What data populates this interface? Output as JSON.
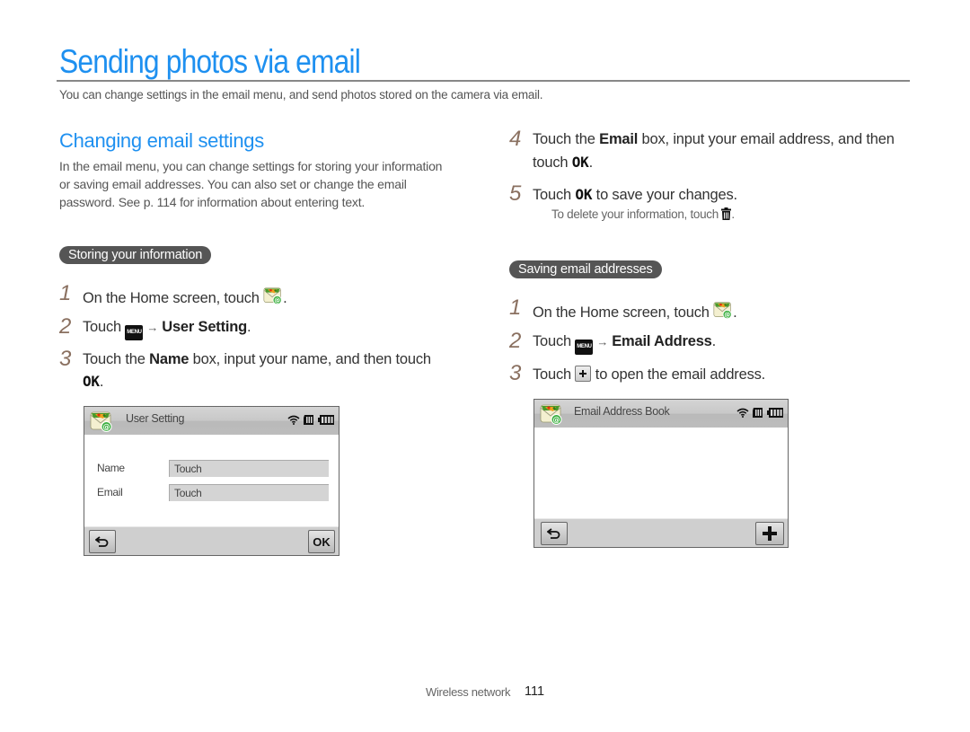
{
  "header": {
    "title": "Sending photos via email",
    "intro": "You can change settings in the email menu, and send photos stored on the camera via email."
  },
  "section": {
    "title": "Changing email settings",
    "description": "In the email menu, you can change settings for storing your information or saving email addresses. You can also set or change the email password. See p. 114 for information about entering text."
  },
  "storing": {
    "label": "Storing your information",
    "steps": [
      {
        "num": "1",
        "pre": "On the Home screen, touch ",
        "post": "."
      },
      {
        "num": "2",
        "pre": "Touch ",
        "menu": "MENU",
        "arrow": "→",
        "bold": "User Setting",
        "post": "."
      },
      {
        "num": "3",
        "pre": "Touch the ",
        "bold": "Name",
        "mid": " box, input your name, and then touch",
        "ok": "OK",
        "post": "."
      },
      {
        "num": "4",
        "pre": "Touch the ",
        "bold": "Email",
        "mid": " box, input your email address, and then",
        "line2": "touch ",
        "ok": "OK",
        "post": "."
      },
      {
        "num": "5",
        "pre": "Touch ",
        "ok": "OK",
        "post": " to save your changes."
      }
    ],
    "note_pre": "To delete your information, touch ",
    "note_post": ".",
    "screen": {
      "title": "User Setting",
      "fields": [
        {
          "label": "Name",
          "value": "Touch"
        },
        {
          "label": "Email",
          "value": "Touch"
        }
      ],
      "ok_label": "OK"
    }
  },
  "saving": {
    "label": "Saving email addresses",
    "steps": [
      {
        "num": "1",
        "pre": "On the Home screen, touch ",
        "post": "."
      },
      {
        "num": "2",
        "pre": "Touch ",
        "menu": "MENU",
        "arrow": "→",
        "bold": "Email Address",
        "post": "."
      },
      {
        "num": "3",
        "pre": "Touch ",
        "post": " to open the email address."
      }
    ],
    "screen": {
      "title": "Email Address Book"
    }
  },
  "footer": {
    "section": "Wireless network",
    "page": "111"
  },
  "colors": {
    "accent": "#1e90f0",
    "pill_bg": "#555555",
    "step_number": "#8a7060"
  },
  "icons": [
    "email-app-icon",
    "menu-icon",
    "arrow-icon",
    "ok-icon",
    "trash-icon",
    "plus-icon",
    "back-icon",
    "wifi-icon",
    "memory-card-icon",
    "battery-icon"
  ]
}
